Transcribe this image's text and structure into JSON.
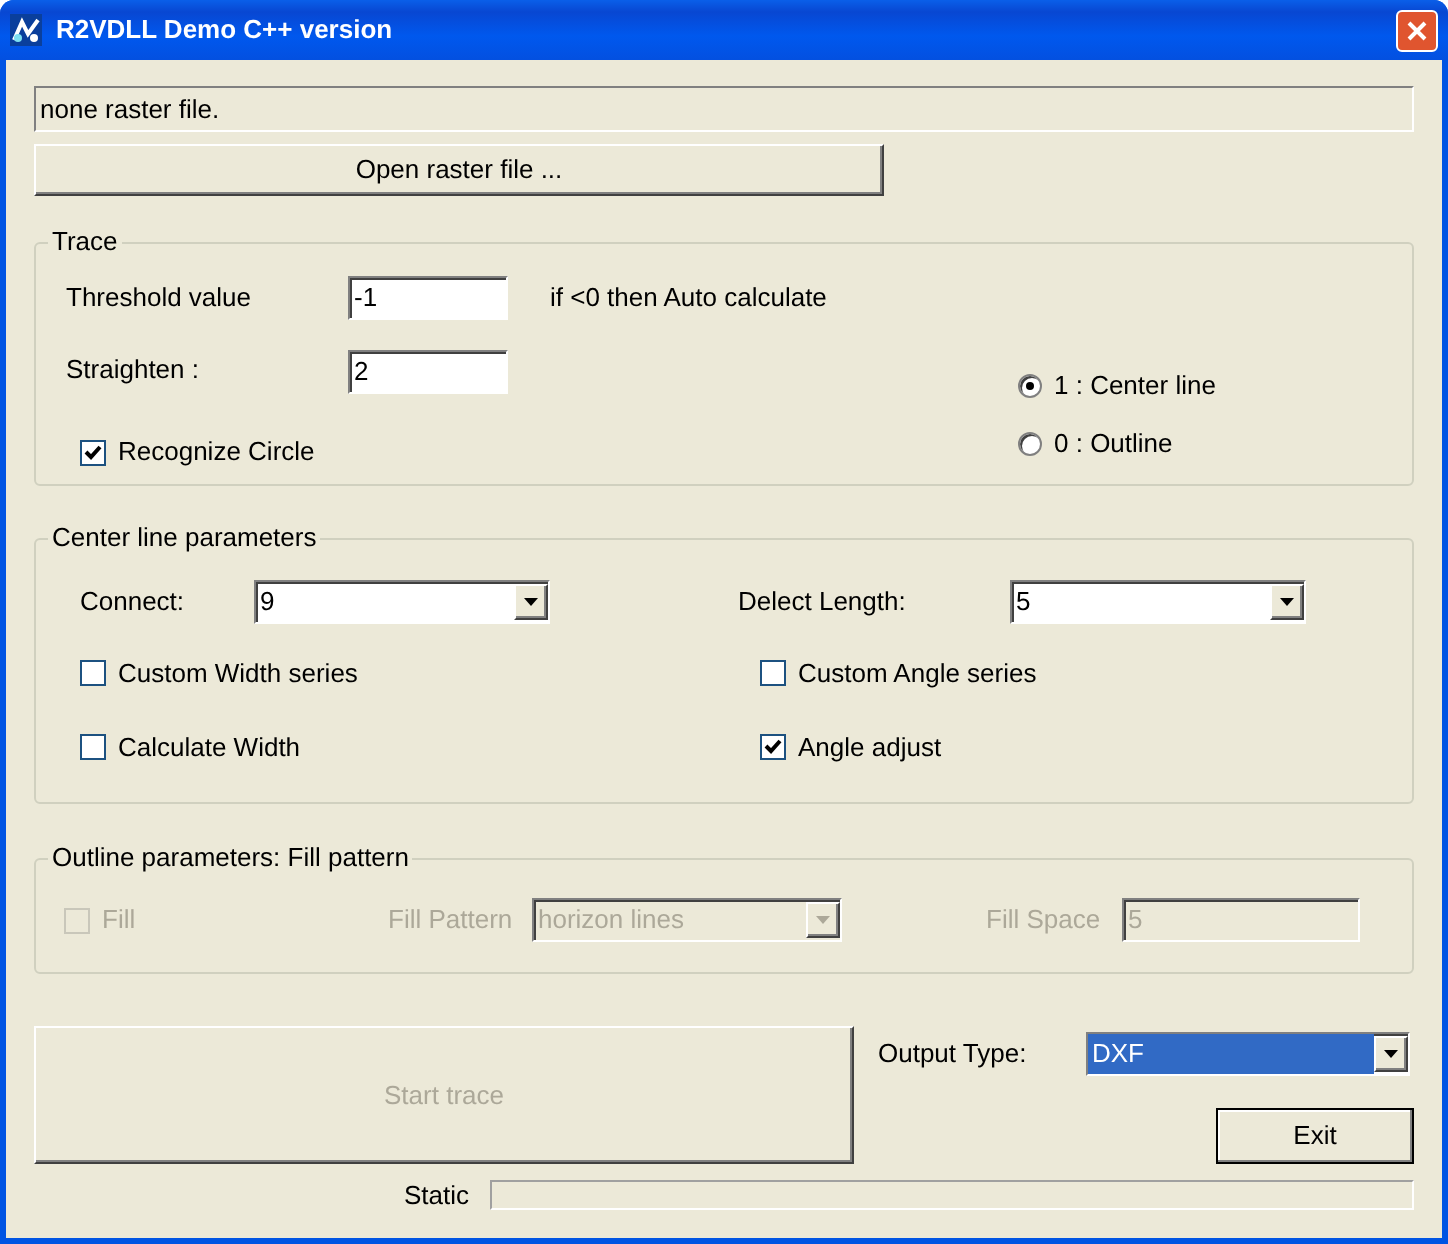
{
  "window": {
    "title": "R2VDLL Demo C++ version"
  },
  "status_text": "none raster file.",
  "open_button": "Open raster file ...",
  "trace": {
    "title": "Trace",
    "threshold": {
      "label": "Threshold value",
      "value": "-1",
      "hint": "if <0 then Auto calculate"
    },
    "straighten": {
      "label": "Straighten :",
      "value": "2"
    },
    "recognize_circle": {
      "label": "Recognize Circle",
      "checked": true
    },
    "modes": [
      {
        "label": "1 : Center line",
        "selected": true
      },
      {
        "label": "0 : Outline",
        "selected": false
      }
    ]
  },
  "center_line": {
    "title": "Center line parameters",
    "connect": {
      "label": "Connect:",
      "value": "9"
    },
    "delect_length": {
      "label": "Delect Length:",
      "value": "5"
    },
    "checkboxes": [
      {
        "label": "Custom Width series",
        "checked": false
      },
      {
        "label": "Custom Angle series",
        "checked": false
      },
      {
        "label": "Calculate Width",
        "checked": false
      },
      {
        "label": "Angle adjust",
        "checked": true
      }
    ]
  },
  "outline": {
    "title": "Outline parameters: Fill pattern",
    "disabled": true,
    "fill": {
      "label": "Fill",
      "checked": false
    },
    "fill_pattern": {
      "label": "Fill Pattern",
      "value": "horizon lines"
    },
    "fill_space": {
      "label": "Fill Space",
      "value": "5"
    }
  },
  "start_button": {
    "label": "Start trace",
    "disabled": true
  },
  "output_type": {
    "label": "Output Type:",
    "value": "DXF"
  },
  "exit_button": "Exit",
  "status_bar": {
    "label": "Static"
  }
}
